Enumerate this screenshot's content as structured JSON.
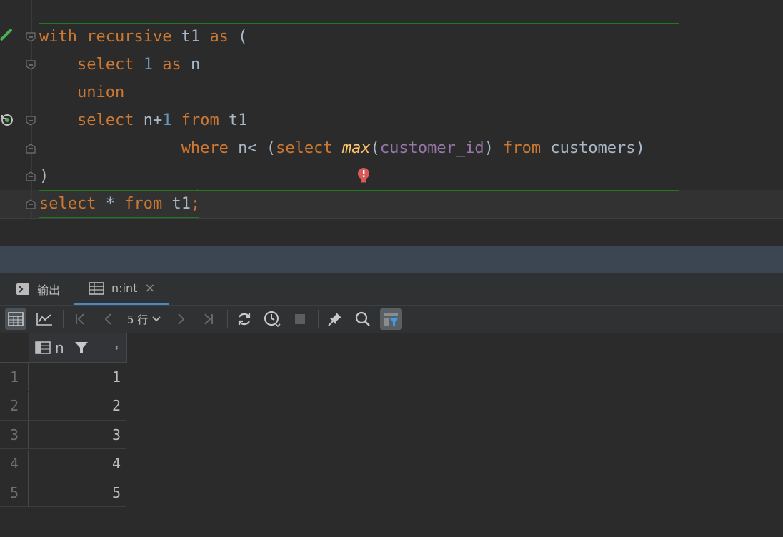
{
  "editor": {
    "lines": [
      [
        {
          "t": "with",
          "c": "kw"
        },
        {
          "t": " ",
          "c": ""
        },
        {
          "t": "recursive",
          "c": "kw"
        },
        {
          "t": " t1 ",
          "c": ""
        },
        {
          "t": "as",
          "c": "kw"
        },
        {
          "t": " (",
          "c": ""
        }
      ],
      [
        {
          "t": "    ",
          "c": ""
        },
        {
          "t": "select",
          "c": "kw"
        },
        {
          "t": " ",
          "c": ""
        },
        {
          "t": "1",
          "c": "num"
        },
        {
          "t": " ",
          "c": ""
        },
        {
          "t": "as",
          "c": "kw"
        },
        {
          "t": " n",
          "c": ""
        }
      ],
      [
        {
          "t": "    ",
          "c": ""
        },
        {
          "t": "union",
          "c": "kw"
        }
      ],
      [
        {
          "t": "    ",
          "c": ""
        },
        {
          "t": "select",
          "c": "kw"
        },
        {
          "t": " n+",
          "c": ""
        },
        {
          "t": "1",
          "c": "num"
        },
        {
          "t": " ",
          "c": ""
        },
        {
          "t": "from",
          "c": "kw"
        },
        {
          "t": " t1",
          "c": ""
        }
      ],
      [
        {
          "t": "               ",
          "c": ""
        },
        {
          "t": "where",
          "c": "kw"
        },
        {
          "t": " n< (",
          "c": ""
        },
        {
          "t": "select",
          "c": "kw"
        },
        {
          "t": " ",
          "c": ""
        },
        {
          "t": "max",
          "c": "fn"
        },
        {
          "t": "(",
          "c": ""
        },
        {
          "t": "customer_id",
          "c": "col"
        },
        {
          "t": ") ",
          "c": ""
        },
        {
          "t": "from",
          "c": "kw"
        },
        {
          "t": " customers)",
          "c": ""
        }
      ],
      [
        {
          "t": ")",
          "c": ""
        }
      ],
      [
        {
          "t": "select",
          "c": "kw"
        },
        {
          "t": " * ",
          "c": ""
        },
        {
          "t": "from",
          "c": "kw"
        },
        {
          "t": " t1",
          "c": ""
        },
        {
          "t": ";",
          "c": "kw"
        }
      ]
    ],
    "gutter_icons": [
      "check-icon",
      "rerun-icon",
      "bulb-icon"
    ]
  },
  "results": {
    "tabs": [
      {
        "label": "输出",
        "icon": "console-icon"
      },
      {
        "label": "n:int",
        "icon": "table-icon",
        "close": "×"
      }
    ],
    "rows_label": "5 行",
    "column": {
      "name": "n",
      "sort_glyph": "⬍"
    },
    "rows": [
      {
        "index": "1",
        "value": "1"
      },
      {
        "index": "2",
        "value": "2"
      },
      {
        "index": "3",
        "value": "3"
      },
      {
        "index": "4",
        "value": "4"
      },
      {
        "index": "5",
        "value": "5"
      }
    ]
  },
  "colors": {
    "keyword": "#cc7832",
    "number": "#6897bb",
    "function": "#ffc66d",
    "column": "#9876aa",
    "text": "#a9b7c6",
    "selection_border": "#1f7a1f"
  }
}
